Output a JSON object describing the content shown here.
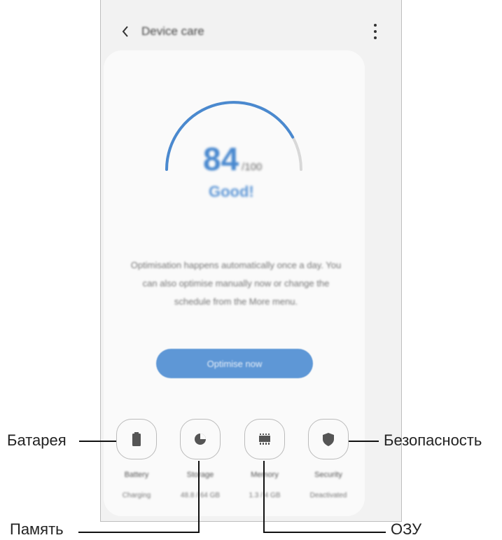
{
  "header": {
    "back_icon": "chevron-left-icon",
    "title": "Device care",
    "more_icon": "more-vertical-icon"
  },
  "score": {
    "value": "84",
    "max": "/100",
    "status": "Good!",
    "progress_fraction": 0.84,
    "arc_color": "#4a89cf",
    "track_color": "#d8d8d8"
  },
  "description": "Optimisation happens automatically once a day. You can also optimise manually now or change the schedule from the More menu.",
  "optimise_button": {
    "label": "Optimise now",
    "color": "#5e97d6"
  },
  "tiles": [
    {
      "icon": "battery-icon",
      "label": "Battery",
      "sub": "Charging"
    },
    {
      "icon": "storage-pie-icon",
      "label": "Storage",
      "sub": "48.8 / 64 GB"
    },
    {
      "icon": "memory-chip-icon",
      "label": "Memory",
      "sub": "1.3 / 4 GB"
    },
    {
      "icon": "shield-icon",
      "label": "Security",
      "sub": "Deactivated"
    }
  ],
  "callouts": {
    "battery": "Батарея",
    "storage": "Память",
    "memory": "ОЗУ",
    "security": "Безопасность"
  }
}
